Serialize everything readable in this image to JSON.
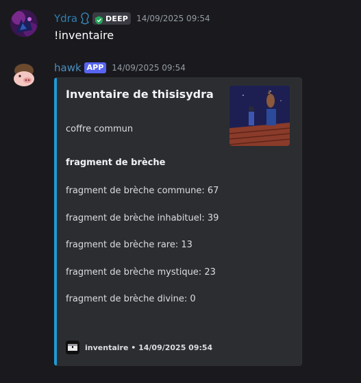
{
  "message1": {
    "username": "Ydra",
    "role_icon": "shield-check-icon",
    "tag": "DEEP",
    "timestamp": "14/09/2025 09:54",
    "content": "!inventaire"
  },
  "message2": {
    "username": "hawk",
    "badge": "APP",
    "timestamp": "14/09/2025 09:54",
    "embed": {
      "accent_color": "#1e9bd7",
      "title": "Inventaire de thisisydra",
      "subtitle": "coffre commun",
      "section_title": "fragment de brèche",
      "lines": [
        "fragment de brèche commune: 67",
        "fragment de brèche inhabituel: 39",
        "fragment de brèche rare: 13",
        "fragment de brèche mystique: 23",
        "fragment de brèche divine: 0"
      ],
      "footer": "inventaire • 14/09/2025 09:54",
      "footer_icon": "chest-icon"
    }
  }
}
